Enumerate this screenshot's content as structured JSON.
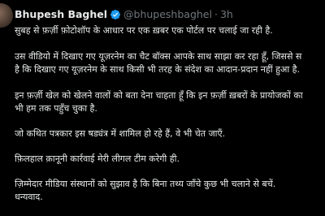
{
  "author": {
    "display_name": "Bhupesh Baghel",
    "handle": "@bhupeshbaghel",
    "separator": "·",
    "time": "3h",
    "verified_icon": "verified-badge-icon",
    "verified_color": "#1d9bf0"
  },
  "tweet": {
    "lines": [
      "सुबह से फ़र्ज़ी फ़ोटोशॉप के आधार पर एक ख़बर एक पोर्टल पर चलाई जा रही है.",
      "उस वीडियो में दिखाए गए यूज़रनेम का चैट बॉक्स आपके साथ साझा कर रहा हूँ, जिससे स",
      "है कि दिखाए गए यूज़रनेम के साथ किसी भी तरह के संदेश का आदान-प्रदान नहीं हुआ है.",
      "इन फ़र्ज़ी खेल को खेलने वालों को बता देना चाहता हूँ कि इन फ़र्ज़ी ख़बरों के प्रायोजकों का",
      "भी हम तक पहुँच चुका है.",
      "जो कथित पत्रकार इस षड्यंत्र में शामिल हो रहे हैं, वे भी चेत जाएँ.",
      "फ़िलहाल क़ानूनी कार्रवाई मेरी लीगल टीम करेगी ही.",
      "ज़िम्मेदार मीडिया संस्थानों को सुझाव है कि बिना तथ्य जाँचे कुछ भी चलाने से बचें.",
      "धन्यवाद."
    ]
  }
}
